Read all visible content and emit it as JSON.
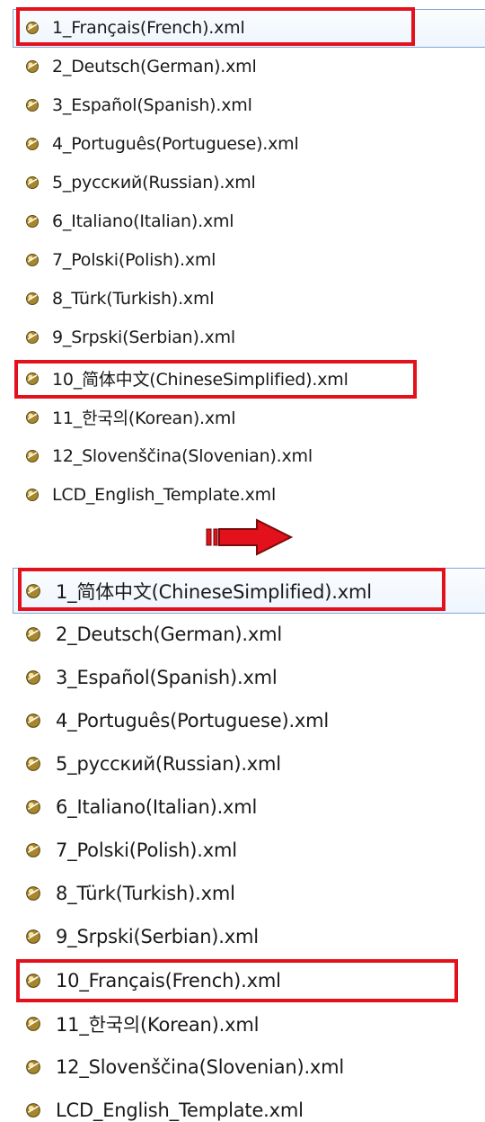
{
  "before": {
    "items": [
      {
        "label": "1_Français(French).xml"
      },
      {
        "label": "2_Deutsch(German).xml"
      },
      {
        "label": "3_Español(Spanish).xml"
      },
      {
        "label": "4_Português(Portuguese).xml"
      },
      {
        "label": "5_русский(Russian).xml"
      },
      {
        "label": "6_Italiano(Italian).xml"
      },
      {
        "label": "7_Polski(Polish).xml"
      },
      {
        "label": "8_Türk(Turkish).xml"
      },
      {
        "label": "9_Srpski(Serbian).xml"
      },
      {
        "label": "10_简体中文(ChineseSimplified).xml"
      },
      {
        "label": "11_한국의(Korean).xml"
      },
      {
        "label": "12_Slovenščina(Slovenian).xml"
      },
      {
        "label": "LCD_English_Template.xml"
      }
    ]
  },
  "after": {
    "items": [
      {
        "label": "1_简体中文(ChineseSimplified).xml"
      },
      {
        "label": "2_Deutsch(German).xml"
      },
      {
        "label": "3_Español(Spanish).xml"
      },
      {
        "label": "4_Português(Portuguese).xml"
      },
      {
        "label": "5_русский(Russian).xml"
      },
      {
        "label": "6_Italiano(Italian).xml"
      },
      {
        "label": "7_Polski(Polish).xml"
      },
      {
        "label": "8_Türk(Turkish).xml"
      },
      {
        "label": "9_Srpski(Serbian).xml"
      },
      {
        "label": "10_Français(French).xml"
      },
      {
        "label": "11_한국의(Korean).xml"
      },
      {
        "label": "12_Slovenščina(Slovenian).xml"
      },
      {
        "label": "LCD_English_Template.xml"
      }
    ]
  },
  "colors": {
    "highlight": "#e3111c",
    "arrow": "#e3111c",
    "selection_border": "#7ea8d6",
    "text": "#1a1a1a"
  },
  "icons": {
    "file": "xml-file-icon",
    "arrow": "right-arrow-icon"
  }
}
